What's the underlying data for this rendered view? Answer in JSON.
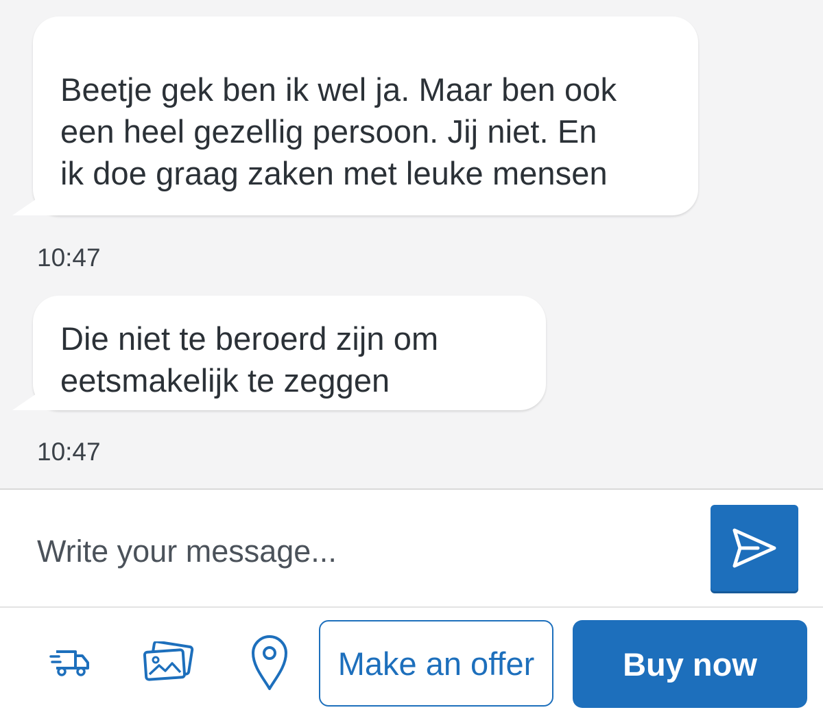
{
  "messages": [
    {
      "text": "Beetje gek ben ik wel ja. Maar ben ook\neen heel gezellig persoon. Jij niet. En\nik doe graag zaken met leuke mensen",
      "time": "10:47"
    },
    {
      "text": "Die niet te beroerd zijn om\neetsmakelijk te zeggen",
      "time": "10:47"
    }
  ],
  "composer": {
    "placeholder": "Write your message...",
    "send_icon": "send-icon"
  },
  "actions": {
    "shipping_icon": "shipping-truck-icon",
    "photos_icon": "photos-icon",
    "location_icon": "location-pin-icon",
    "offer_label": "Make an offer",
    "buy_label": "Buy now"
  },
  "colors": {
    "accent": "#1d6fbc",
    "chat_background": "#f4f4f5",
    "bubble": "#ffffff",
    "text": "#2b3137"
  }
}
